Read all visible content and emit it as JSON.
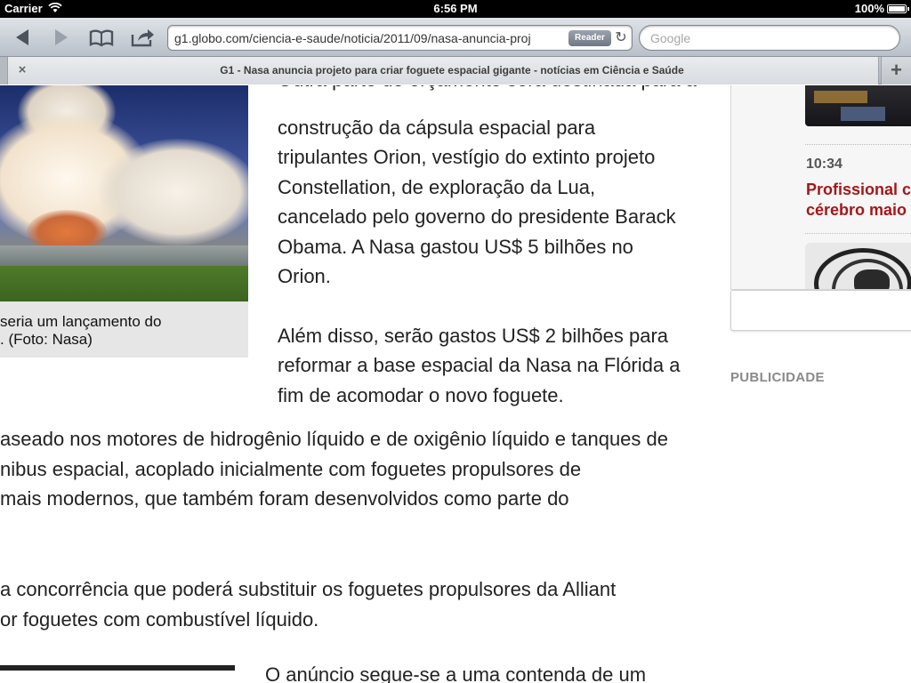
{
  "status_bar": {
    "carrier": "Carrier",
    "time": "6:56 PM",
    "battery": "100%"
  },
  "toolbar": {
    "url": "g1.globo.com/ciencia-e-saude/noticia/2011/09/nasa-anuncia-proj",
    "reader_label": "Reader",
    "search_placeholder": "Google",
    "icons": [
      "back-icon",
      "forward-icon",
      "bookmarks-icon",
      "share-icon",
      "reload-icon"
    ]
  },
  "tab": {
    "title": "G1 - Nasa anuncia projeto para criar foguete espacial gigante - notícias em Ciência e Saúde",
    "close": "×",
    "add": "+"
  },
  "article": {
    "caption_lines": [
      "seria um lançamento do",
      ". (Foto: Nasa)"
    ],
    "column_lines_p1": [
      "construção da cápsula espacial para",
      "tripulantes Orion, vestígio do extinto projeto",
      "Constellation, de exploração da Lua,",
      "cancelado pelo governo do presidente Barack",
      "Obama. A Nasa gastou US$ 5 bilhões no",
      "Orion."
    ],
    "column_lines_p2": [
      "Além disso, serão gastos US$ 2 bilhões para",
      "reformar a base espacial da Nasa na Flórida a",
      "fim de acomodar o novo foguete."
    ],
    "wide_p1": [
      "aseado nos motores de hidrogênio líquido e de oxigênio líquido e tanques de",
      "nibus espacial, acoplado inicialmente com foguetes propulsores de",
      "mais modernos, que também foram desenvolvidos como parte do"
    ],
    "wide_p2": [
      "a concorrência que poderá substituir os foguetes propulsores da Alliant",
      "or foguetes com combustível líquido."
    ],
    "bottom_line": "O anúncio segue-se a uma contenda de um"
  },
  "sidebar": {
    "news_time": "10:34",
    "news_title_lines": [
      "Profissional c",
      "cérebro maio"
    ],
    "publicidade": "PUBLICIDADE"
  }
}
